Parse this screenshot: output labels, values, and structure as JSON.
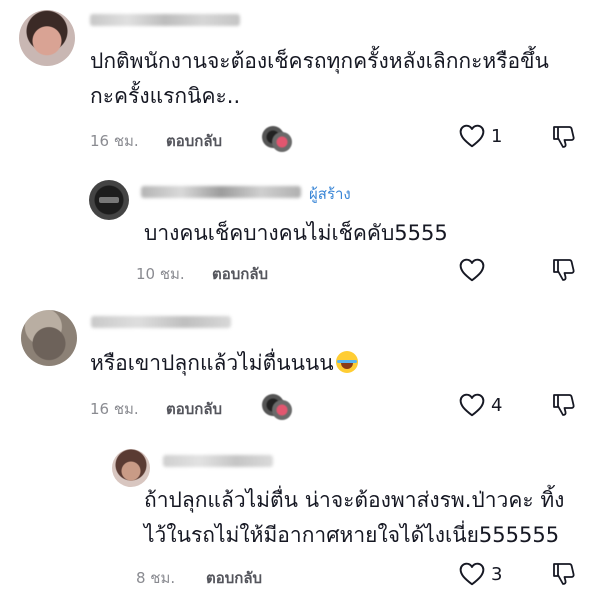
{
  "comments": [
    {
      "text_lines": [
        "ปกติพนักงานจะต้องเช็ครถทุกครั้งหลังเลิกกะหรือขึ้น",
        "กะครั้งแรกนิคะ.."
      ],
      "time": "16 ชม.",
      "reply_label": "ตอบกลับ",
      "like_count": "1"
    },
    {
      "creator_badge": "ผู้สร้าง",
      "text_lines": [
        "บางคนเช็คบางคนไม่เช็คคับ5555"
      ],
      "time": "10 ชม.",
      "reply_label": "ตอบกลับ",
      "like_count": ""
    },
    {
      "text_lines": [
        "หรือเขาปลุกแล้วไม่ตื่นนนน"
      ],
      "emoji": "face-with-tears-of-joy",
      "time": "16 ชม.",
      "reply_label": "ตอบกลับ",
      "like_count": "4"
    },
    {
      "text_lines": [
        "ถ้าปลุกแล้วไม่ตื่น น่าจะต้องพาส่งรพ.ป่าวคะ ทิ้ง",
        "ไว้ในรถไม่ให้มีอากาศหายใจได้ไงเนี่ย555555"
      ],
      "time": "8 ชม.",
      "reply_label": "ตอบกลับ",
      "like_count": "3"
    }
  ],
  "icons": {
    "like": "heart-outline-icon",
    "dislike": "thumbs-down-outline-icon"
  },
  "colors": {
    "text": "#161823",
    "meta": "#8a8b91",
    "creator_badge": "#3a86d6"
  }
}
